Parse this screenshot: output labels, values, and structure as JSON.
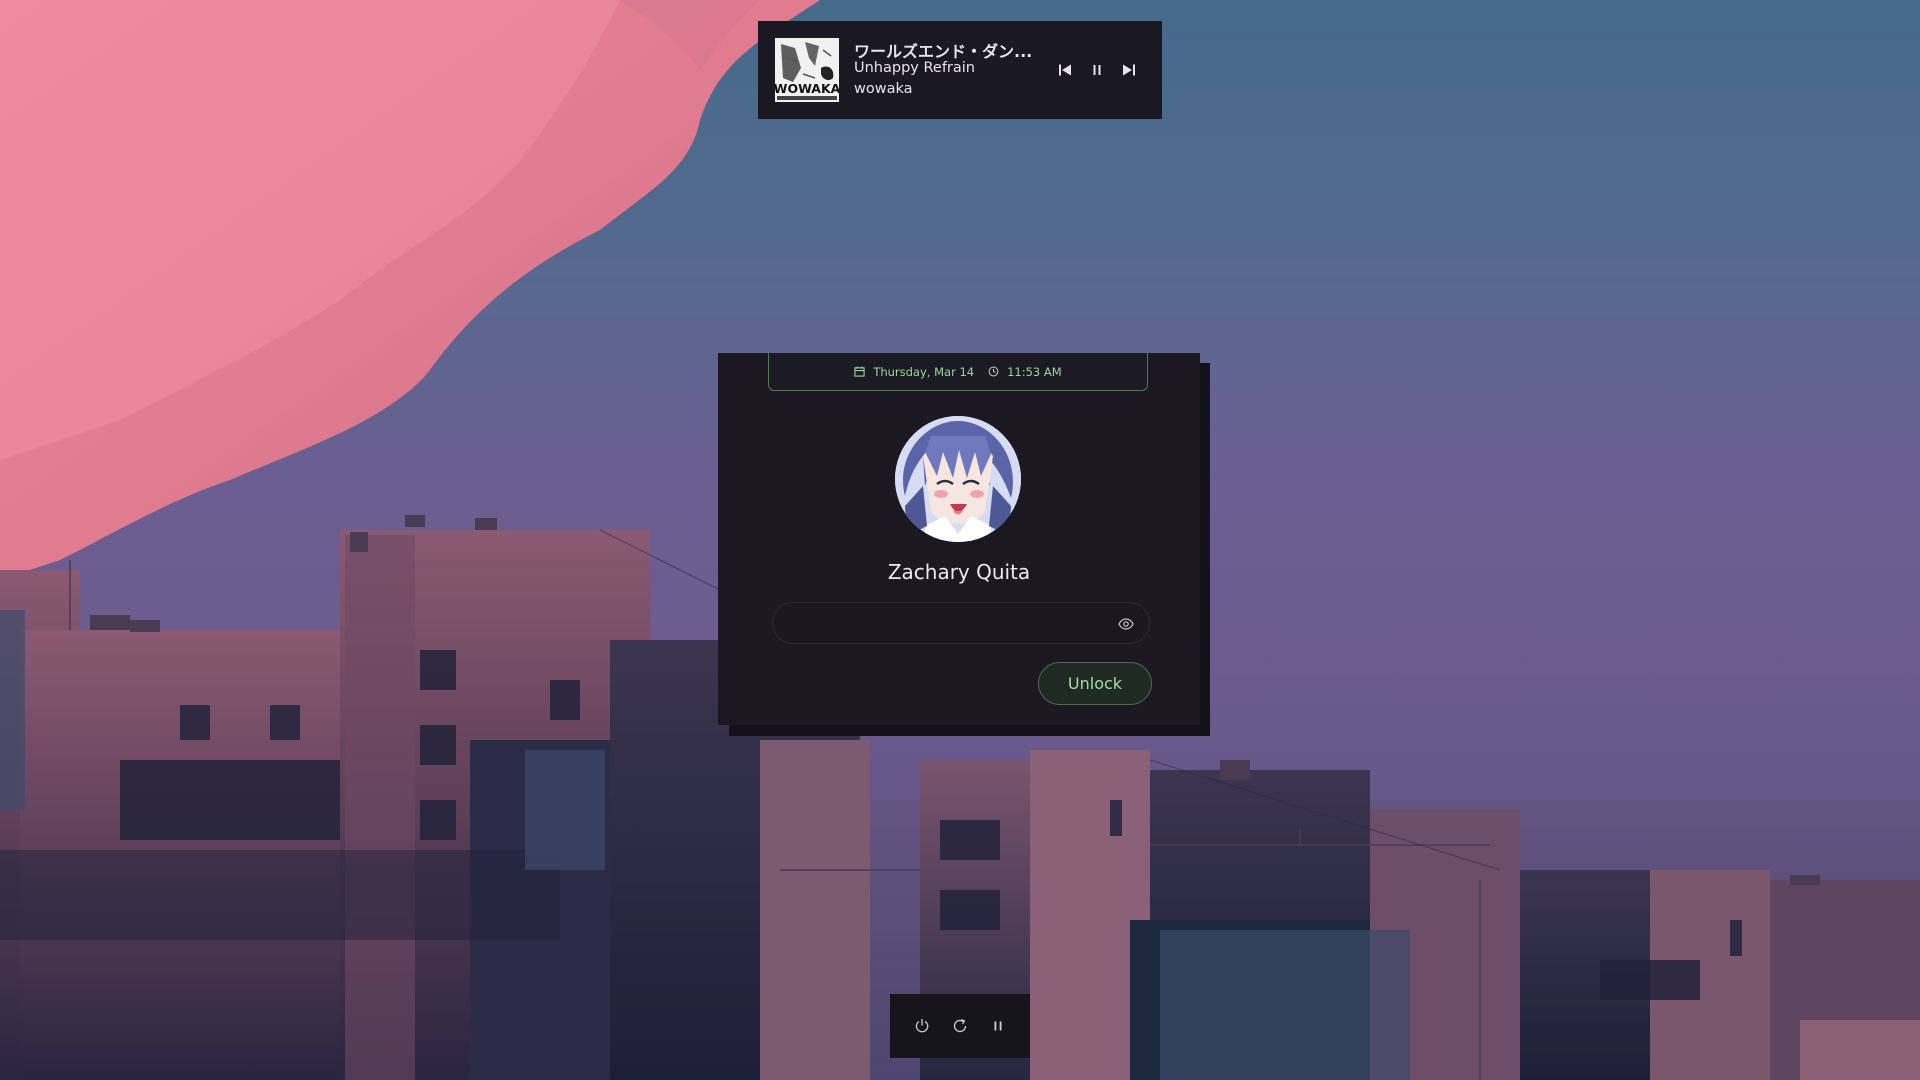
{
  "media": {
    "title": "ワールズエンド・ダン...",
    "album": "Unhappy Refrain",
    "artist": "wowaka",
    "album_art_text": "WOWAKA",
    "controls": {
      "previous_icon": "skip-previous-icon",
      "pause_icon": "pause-icon",
      "next_icon": "skip-next-icon"
    }
  },
  "lock": {
    "date": "Thursday, Mar 14",
    "time": "11:53 AM",
    "date_icon": "calendar-icon",
    "time_icon": "clock-icon",
    "user_name": "Zachary Quita",
    "password_placeholder": "",
    "reveal_icon": "eye-icon",
    "unlock_label": "Unlock"
  },
  "power": {
    "shutdown_icon": "power-icon",
    "restart_icon": "restart-icon",
    "suspend_icon": "pause-icon"
  },
  "colors": {
    "accent_green": "#9fd39f",
    "card_bg": "#1b1821",
    "media_bg": "#1a1822",
    "sky_pink": "#e08296",
    "sky_blue": "#456a8b"
  }
}
